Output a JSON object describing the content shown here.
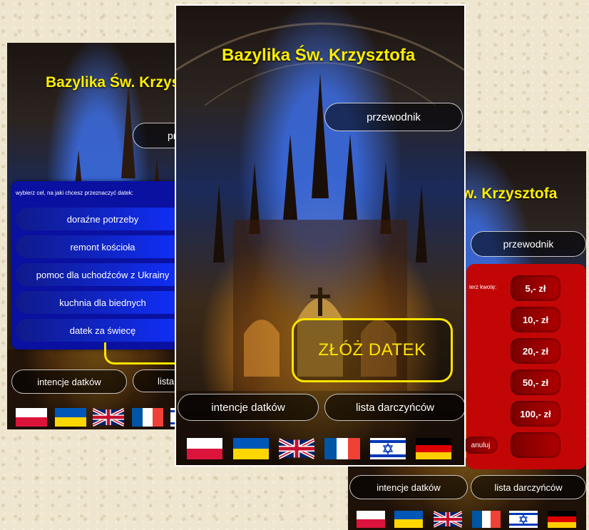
{
  "app": {
    "title": "Bazylika Św. Krzysztofa",
    "title_partial_right": "w. Krzysztofa"
  },
  "buttons": {
    "guide": "przewodnik",
    "donate": "ZŁÓŻ DATEK",
    "intentions": "intencje datków",
    "donors": "lista darczyńców"
  },
  "purpose_panel": {
    "prompt": "wybierz cel, na jaki chcesz przeznaczyć datek:",
    "options": [
      "doraźne potrzeby",
      "remont kościoła",
      "pomoc dla uchodźców z Ukrainy",
      "kuchnia dla biednych",
      "datek za świecę"
    ]
  },
  "amount_panel": {
    "prompt": "ierz kwotę:",
    "amounts": [
      "5,- zł",
      "10,- zł",
      "20,- zł",
      "50,- zł",
      "100,- zł"
    ],
    "other": "inna...",
    "cancel": "anuluj"
  },
  "languages": [
    "Polish",
    "Ukrainian",
    "English",
    "French",
    "Hebrew",
    "German"
  ],
  "colors": {
    "title": "#ffee00",
    "purpose_panel": "#0a10a0",
    "amount_panel": "#c20606",
    "donate_border": "#ffe400"
  }
}
